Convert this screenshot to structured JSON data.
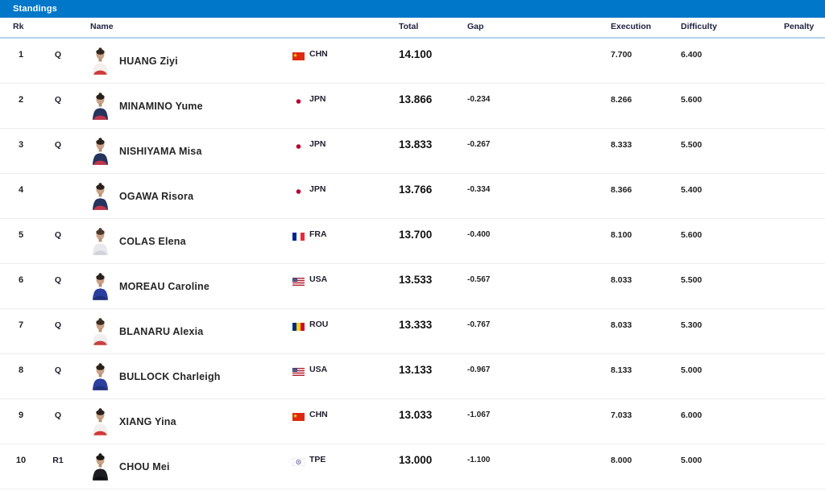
{
  "topbar": {
    "title": "Standings"
  },
  "colors": {
    "topbar": "#0077C8",
    "header_underline": "#AFD3EE",
    "row_border": "#ECECEC"
  },
  "table": {
    "columns": {
      "rk": "Rk",
      "name": "Name",
      "total": "Total",
      "gap": "Gap",
      "execution": "Execution",
      "difficulty": "Difficulty",
      "penalty": "Penalty"
    },
    "rows": [
      {
        "rank": "1",
        "qual": "Q",
        "name": "HUANG Ziyi",
        "noc": "CHN",
        "total": "14.100",
        "gap": "",
        "execution": "7.700",
        "difficulty": "6.400",
        "penalty": "",
        "avatar": {
          "hair": "#33261f",
          "top": "#f3efec",
          "accent": "#cf3a3a"
        }
      },
      {
        "rank": "2",
        "qual": "Q",
        "name": "MINAMINO Yume",
        "noc": "JPN",
        "total": "13.866",
        "gap": "-0.234",
        "execution": "8.266",
        "difficulty": "5.600",
        "penalty": "",
        "avatar": {
          "hair": "#2b211c",
          "top": "#26335c",
          "accent": "#c3344a"
        }
      },
      {
        "rank": "3",
        "qual": "Q",
        "name": "NISHIYAMA Misa",
        "noc": "JPN",
        "total": "13.833",
        "gap": "-0.267",
        "execution": "8.333",
        "difficulty": "5.500",
        "penalty": "",
        "avatar": {
          "hair": "#2b211c",
          "top": "#26335c",
          "accent": "#c3344a"
        }
      },
      {
        "rank": "4",
        "qual": "",
        "name": "OGAWA Risora",
        "noc": "JPN",
        "total": "13.766",
        "gap": "-0.334",
        "execution": "8.366",
        "difficulty": "5.400",
        "penalty": "",
        "avatar": {
          "hair": "#2b211c",
          "top": "#26335c",
          "accent": "#c3344a"
        }
      },
      {
        "rank": "5",
        "qual": "Q",
        "name": "COLAS Elena",
        "noc": "FRA",
        "total": "13.700",
        "gap": "-0.400",
        "execution": "8.100",
        "difficulty": "5.600",
        "penalty": "",
        "avatar": {
          "hair": "#4a382c",
          "top": "#e9e9ec",
          "accent": "#cfd2da"
        }
      },
      {
        "rank": "6",
        "qual": "Q",
        "name": "MOREAU Caroline",
        "noc": "USA",
        "total": "13.533",
        "gap": "-0.567",
        "execution": "8.033",
        "difficulty": "5.500",
        "penalty": "",
        "avatar": {
          "hair": "#2b211c",
          "top": "#2b3f9e",
          "accent": "#20307c"
        }
      },
      {
        "rank": "7",
        "qual": "Q",
        "name": "BLANARU Alexia",
        "noc": "ROU",
        "total": "13.333",
        "gap": "-0.767",
        "execution": "8.033",
        "difficulty": "5.300",
        "penalty": "",
        "avatar": {
          "hair": "#3a2c23",
          "top": "#efefef",
          "accent": "#c94040"
        }
      },
      {
        "rank": "8",
        "qual": "Q",
        "name": "BULLOCK Charleigh",
        "noc": "USA",
        "total": "13.133",
        "gap": "-0.967",
        "execution": "8.133",
        "difficulty": "5.000",
        "penalty": "",
        "avatar": {
          "hair": "#2b211c",
          "top": "#2b3f9e",
          "accent": "#20307c"
        }
      },
      {
        "rank": "9",
        "qual": "Q",
        "name": "XIANG Yina",
        "noc": "CHN",
        "total": "13.033",
        "gap": "-1.067",
        "execution": "7.033",
        "difficulty": "6.000",
        "penalty": "",
        "avatar": {
          "hair": "#2b211c",
          "top": "#f3efec",
          "accent": "#cf3a3a"
        }
      },
      {
        "rank": "10",
        "qual": "R1",
        "name": "CHOU Mei",
        "noc": "TPE",
        "total": "13.000",
        "gap": "-1.100",
        "execution": "8.000",
        "difficulty": "5.000",
        "penalty": "",
        "avatar": {
          "hair": "#1d1714",
          "top": "#1d1d22",
          "accent": "#101014"
        }
      }
    ]
  }
}
